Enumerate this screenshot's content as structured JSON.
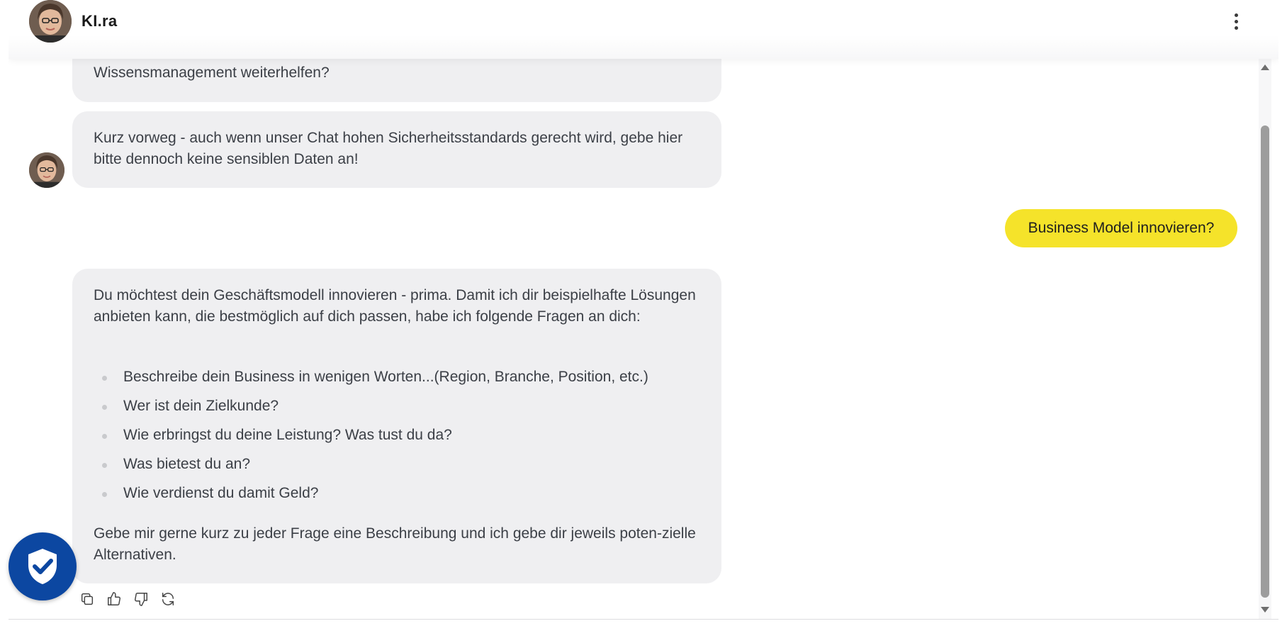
{
  "header": {
    "title": "KI.ra",
    "menu_icon": "kebab-menu-icon"
  },
  "messages": {
    "assistant_partial": {
      "text": "Wissensmanagement weiterhelfen?"
    },
    "assistant_notice": {
      "text": "Kurz vorweg - auch wenn unser Chat hohen Sicherheitsstandards gerecht wird, gebe hier bitte dennoch keine sensiblen Daten an!"
    },
    "user_question": {
      "text": "Business Model innovieren?"
    },
    "assistant_reply": {
      "intro": "Du möchtest dein Geschäftsmodell innovieren - prima. Damit ich dir beispielhafte Lösungen anbieten kann, die bestmöglich auf dich passen, habe ich folgende Fragen an dich:",
      "questions": [
        "Beschreibe dein Business in wenigen Worten...(Region, Branche, Position, etc.)",
        "Wer ist dein Zielkunde?",
        "Wie erbringst du deine Leistung? Was tust du da?",
        "Was bietest du an?",
        "Wie verdienst du damit Geld?"
      ],
      "outro": "Gebe mir gerne kurz zu jeder Frage eine Beschreibung und ich gebe dir jeweils poten-zielle Alternativen."
    }
  },
  "actions": [
    "copy-icon",
    "thumbs-up-icon",
    "thumbs-down-icon",
    "regenerate-icon"
  ],
  "colors": {
    "user_bubble": "#f5e32a",
    "assistant_bubble": "#efeff1",
    "shield_button": "#0c47a1",
    "scrollbar_thumb": "#9d9d9d"
  }
}
